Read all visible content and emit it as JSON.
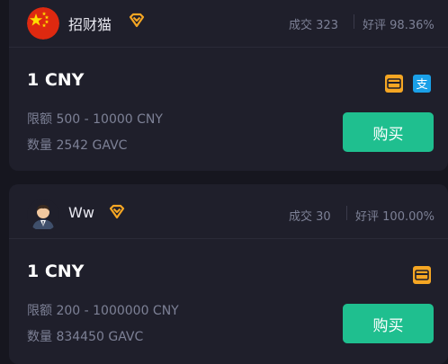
{
  "offers": [
    {
      "merchant_name": "招财猫",
      "avatar_icon": "china-flag-icon",
      "trades_label": "成交",
      "trades_count": "323",
      "rating_label": "好评",
      "rating_value": "98.36%",
      "price": "1 CNY",
      "limit_label": "限额",
      "limit_value": "500 - 10000 CNY",
      "quantity_label": "数量",
      "quantity_value": "2542 GAVC",
      "payment_icons": [
        "bank-card-icon",
        "alipay-icon"
      ],
      "buy_label": "购买"
    },
    {
      "merchant_name": "Ww",
      "avatar_icon": "user-avatar-icon",
      "trades_label": "成交",
      "trades_count": "30",
      "rating_label": "好评",
      "rating_value": "100.00%",
      "price": "1 CNY",
      "limit_label": "限额",
      "limit_value": "200 - 1000000 CNY",
      "quantity_label": "数量",
      "quantity_value": "834450 GAVC",
      "payment_icons": [
        "bank-card-icon"
      ],
      "buy_label": "购买"
    }
  ],
  "colors": {
    "background": "#16161f",
    "card": "#1f1f2b",
    "buy_button": "#1fbf8f",
    "badge": "#f5a623",
    "bank_card": "#f5a623",
    "alipay": "#1aa0e8",
    "muted_text": "#7d8196"
  }
}
